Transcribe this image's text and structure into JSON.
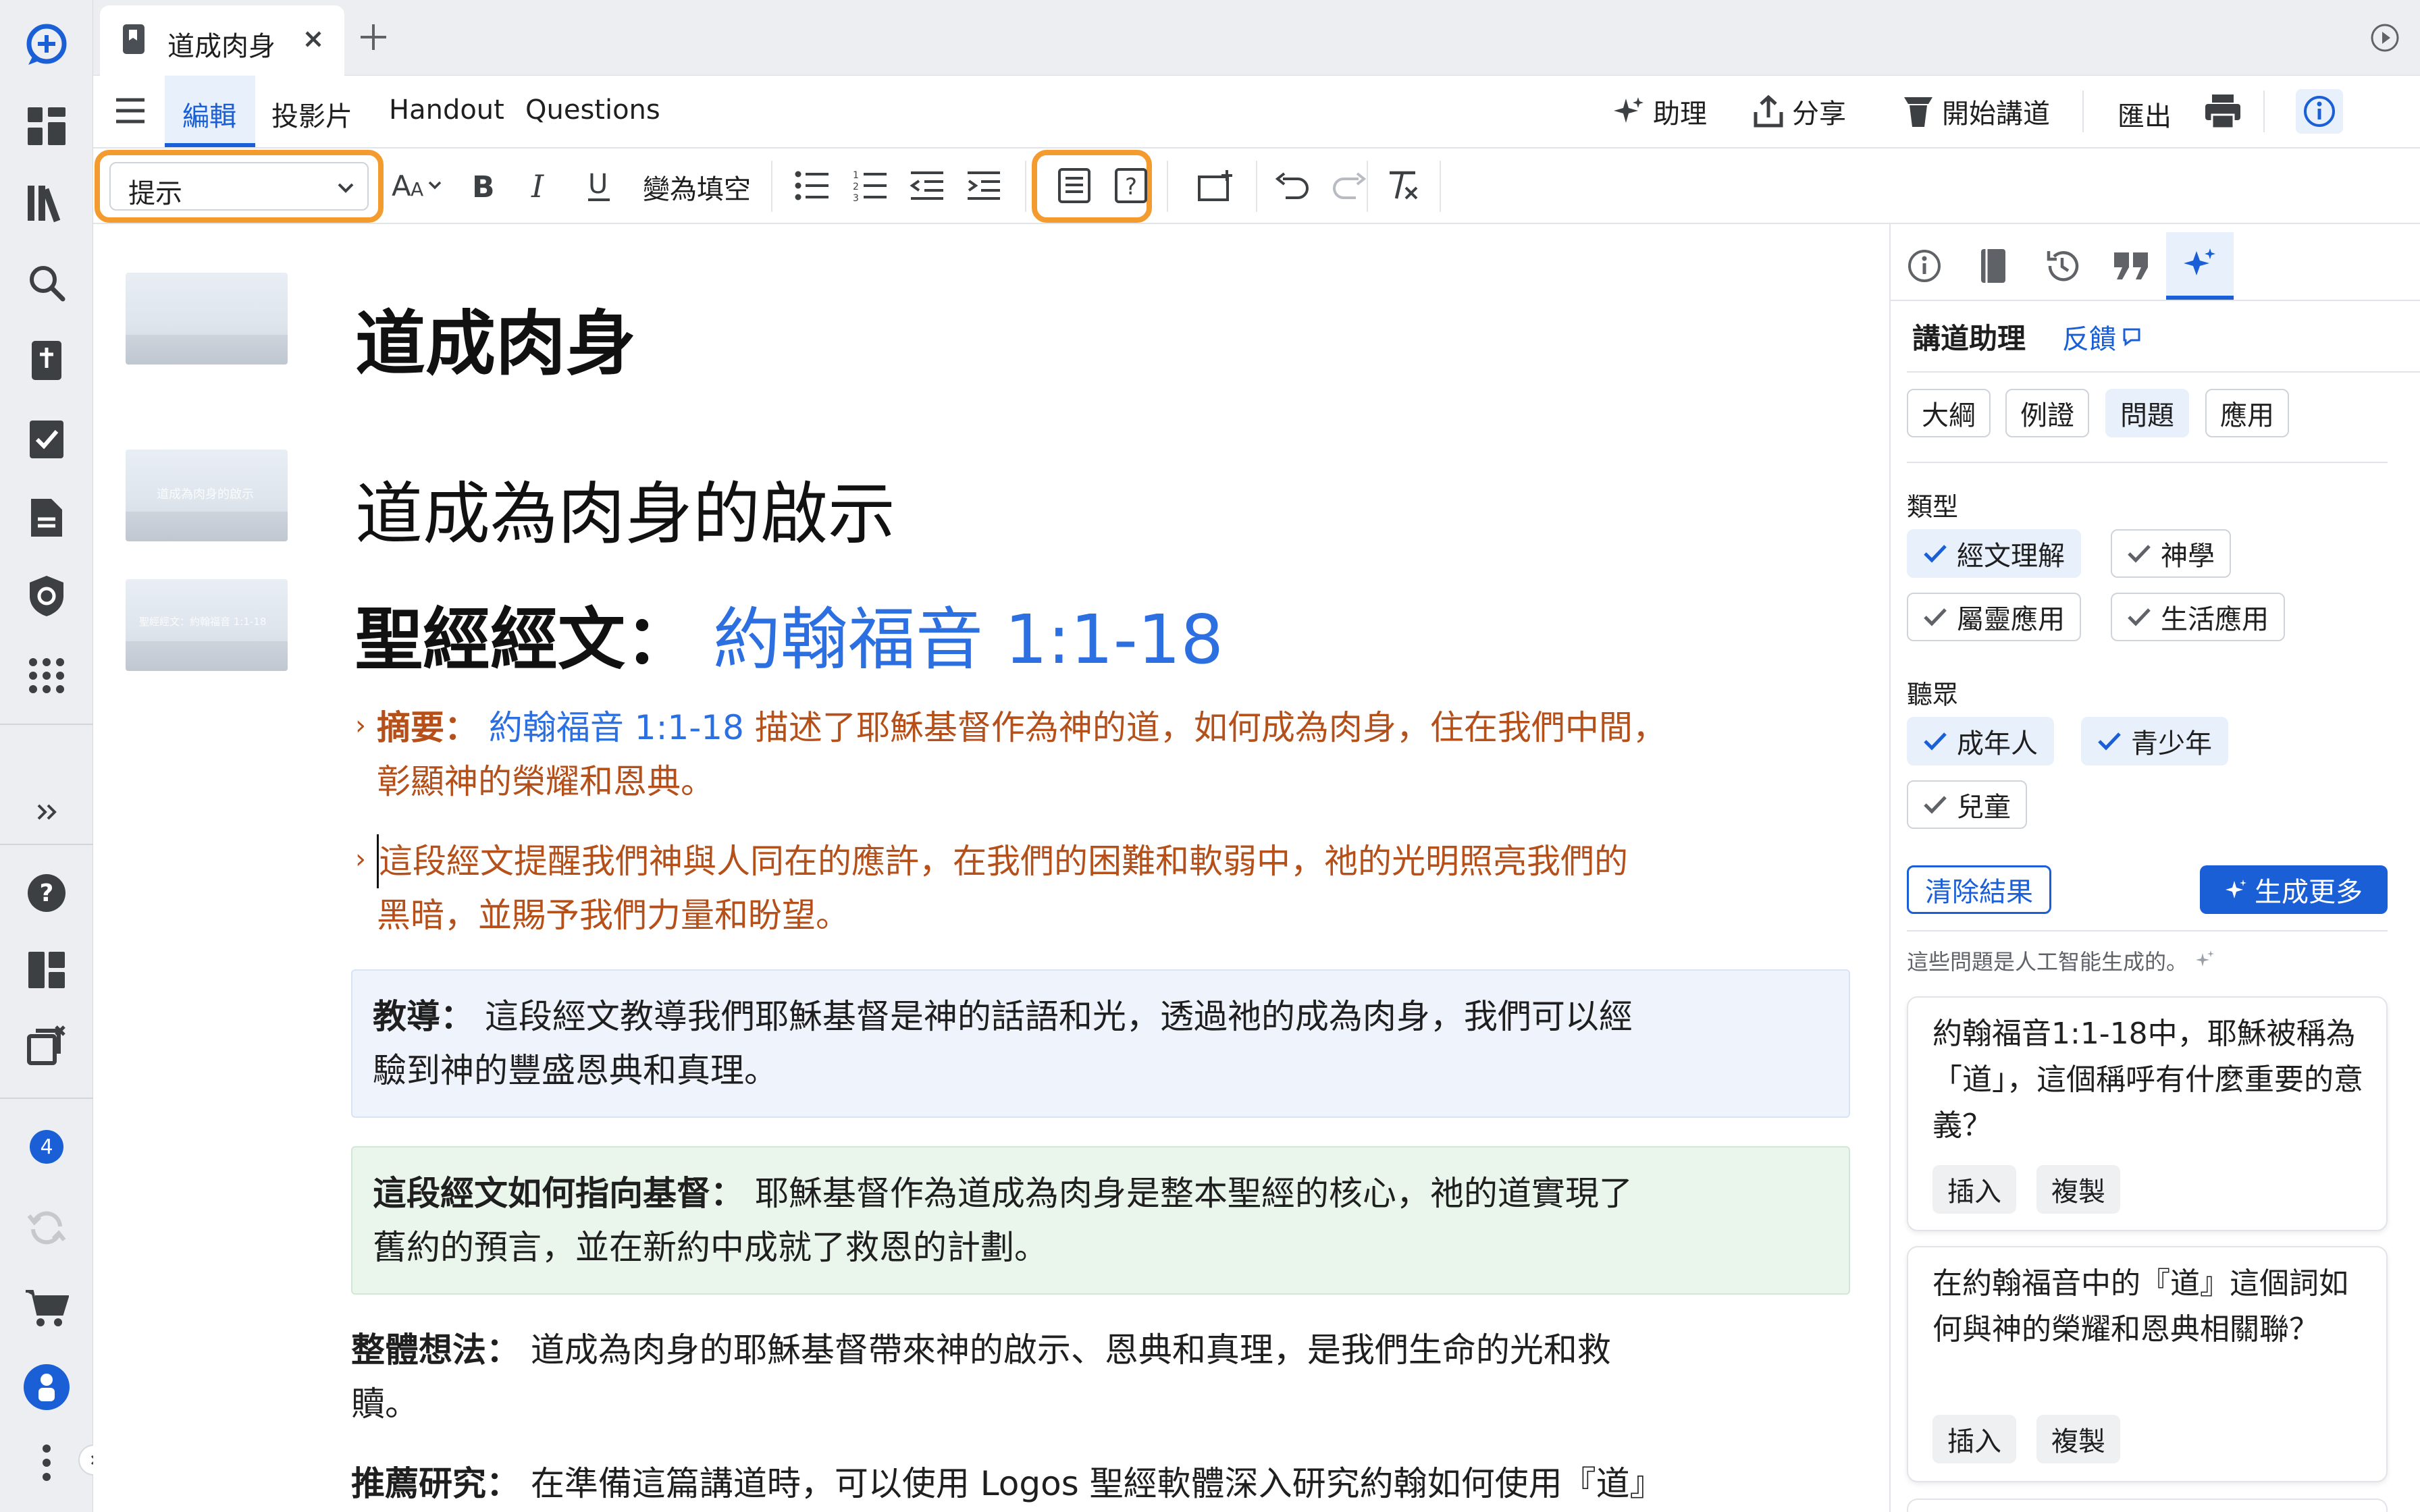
{
  "tab": {
    "title": "道成肉身"
  },
  "menu": {
    "edit": "編輯",
    "slides": "投影片",
    "handout": "Handout",
    "questions": "Questions",
    "assistant": "助理",
    "share": "分享",
    "start_preaching": "開始講道",
    "export": "匯出"
  },
  "toolbar": {
    "style_select": "提示",
    "blank_toggle": "變為填空"
  },
  "doc": {
    "title": "道成肉身",
    "heading": "道成為肉身的啟示",
    "scripture_label": "聖經經文：",
    "scripture_ref": "約翰福音 1:1-18",
    "thumb2_caption": "道成為肉身的啟示",
    "thumb3_caption": "聖經經文：約翰福音 1:1-18",
    "summary_label": "摘要：",
    "summary_ref": "約翰福音 1:1-18",
    "summary_text_1": "描述了耶穌基督作為神的道，如何成為肉身，住在我們中間，",
    "summary_text_2": "彰顯神的榮耀和恩典。",
    "reminder_1": "這段經文提醒我們神與人同在的應許，在我們的困難和軟弱中，祂的光明照亮我們的",
    "reminder_2": "黑暗，並賜予我們力量和盼望。",
    "teaching_label": "教導：",
    "teaching_text_1": "這段經文教導我們耶穌基督是神的話語和光，透過祂的成為肉身，我們可以經",
    "teaching_text_2": "驗到神的豐盛恩典和真理。",
    "christ_label": "這段經文如何指向基督：",
    "christ_text_1": "耶穌基督作為道成為肉身是整本聖經的核心，祂的道實現了",
    "christ_text_2": "舊約的預言，並在新約中成就了救恩的計劃。",
    "big_idea_label": "整體想法：",
    "big_idea_text_1": "道成為肉身的耶穌基督帶來神的啟示、恩典和真理，是我們生命的光和救",
    "big_idea_text_2": "贖。",
    "study_label": "推薦研究：",
    "study_text": "在準備這篇講道時，可以使用 Logos 聖經軟體深入研究約翰如何使用『道』"
  },
  "panel": {
    "title": "講道助理",
    "feedback": "反饋",
    "categories": [
      "大綱",
      "例證",
      "問題",
      "應用"
    ],
    "selected_category": "問題",
    "type_label": "類型",
    "types": [
      {
        "label": "經文理解",
        "checked": true
      },
      {
        "label": "神學",
        "checked": false
      },
      {
        "label": "屬靈應用",
        "checked": false
      },
      {
        "label": "生活應用",
        "checked": false
      }
    ],
    "audience_label": "聽眾",
    "audiences": [
      {
        "label": "成年人",
        "checked": true
      },
      {
        "label": "青少年",
        "checked": true
      },
      {
        "label": "兒童",
        "checked": false
      }
    ],
    "clear_label": "清除結果",
    "generate_label": "生成更多",
    "ai_note": "這些問題是人工智能生成的。",
    "questions": [
      {
        "text": "約翰福音1:1-18中，耶穌被稱為「道」，這個稱呼有什麼重要的意義？",
        "insert": "插入",
        "copy": "複製"
      },
      {
        "text": "在約翰福音中的『道』這個詞如何與神的榮耀和恩典相關聯？",
        "insert": "插入",
        "copy": "複製"
      }
    ]
  },
  "rail": {
    "badge_count": "4"
  },
  "colors": {
    "accent": "#1a5fd6",
    "highlight": "#f39b2f",
    "summary": "#b5501a",
    "link": "#2c6fe0"
  }
}
